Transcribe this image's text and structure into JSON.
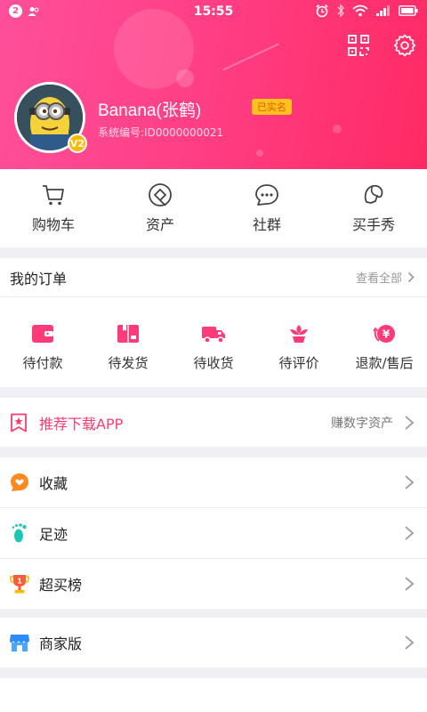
{
  "status_bar": {
    "notification_count": "2",
    "time": "15:55"
  },
  "profile": {
    "name": "Banana(张鹤)",
    "verified_badge": "已实名",
    "system_id": "系统编号:ID0000000021",
    "vip_level": "V2"
  },
  "quick_actions": [
    {
      "label": "购物车",
      "icon": "cart-icon"
    },
    {
      "label": "资产",
      "icon": "assets-icon"
    },
    {
      "label": "社群",
      "icon": "chat-icon"
    },
    {
      "label": "买手秀",
      "icon": "buyer-show-icon"
    }
  ],
  "orders": {
    "title": "我的订单",
    "view_all": "查看全部",
    "items": [
      {
        "label": "待付款",
        "icon": "wallet-icon"
      },
      {
        "label": "待发货",
        "icon": "package-icon"
      },
      {
        "label": "待收货",
        "icon": "truck-icon"
      },
      {
        "label": "待评价",
        "icon": "flower-icon"
      },
      {
        "label": "退款/售后",
        "icon": "refund-icon"
      }
    ]
  },
  "recommend": {
    "label": "推荐下载APP",
    "right_text": "赚数字资产"
  },
  "menu": [
    {
      "label": "收藏",
      "icon": "favorite-icon"
    },
    {
      "label": "足迹",
      "icon": "footprint-icon"
    },
    {
      "label": "超买榜",
      "icon": "trophy-icon"
    },
    {
      "label": "商家版",
      "icon": "store-icon"
    }
  ],
  "colors": {
    "header_start": "#ff4f9a",
    "header_end": "#ff2a64",
    "accent": "#ff3a6e",
    "badge": "#ffc21c"
  }
}
